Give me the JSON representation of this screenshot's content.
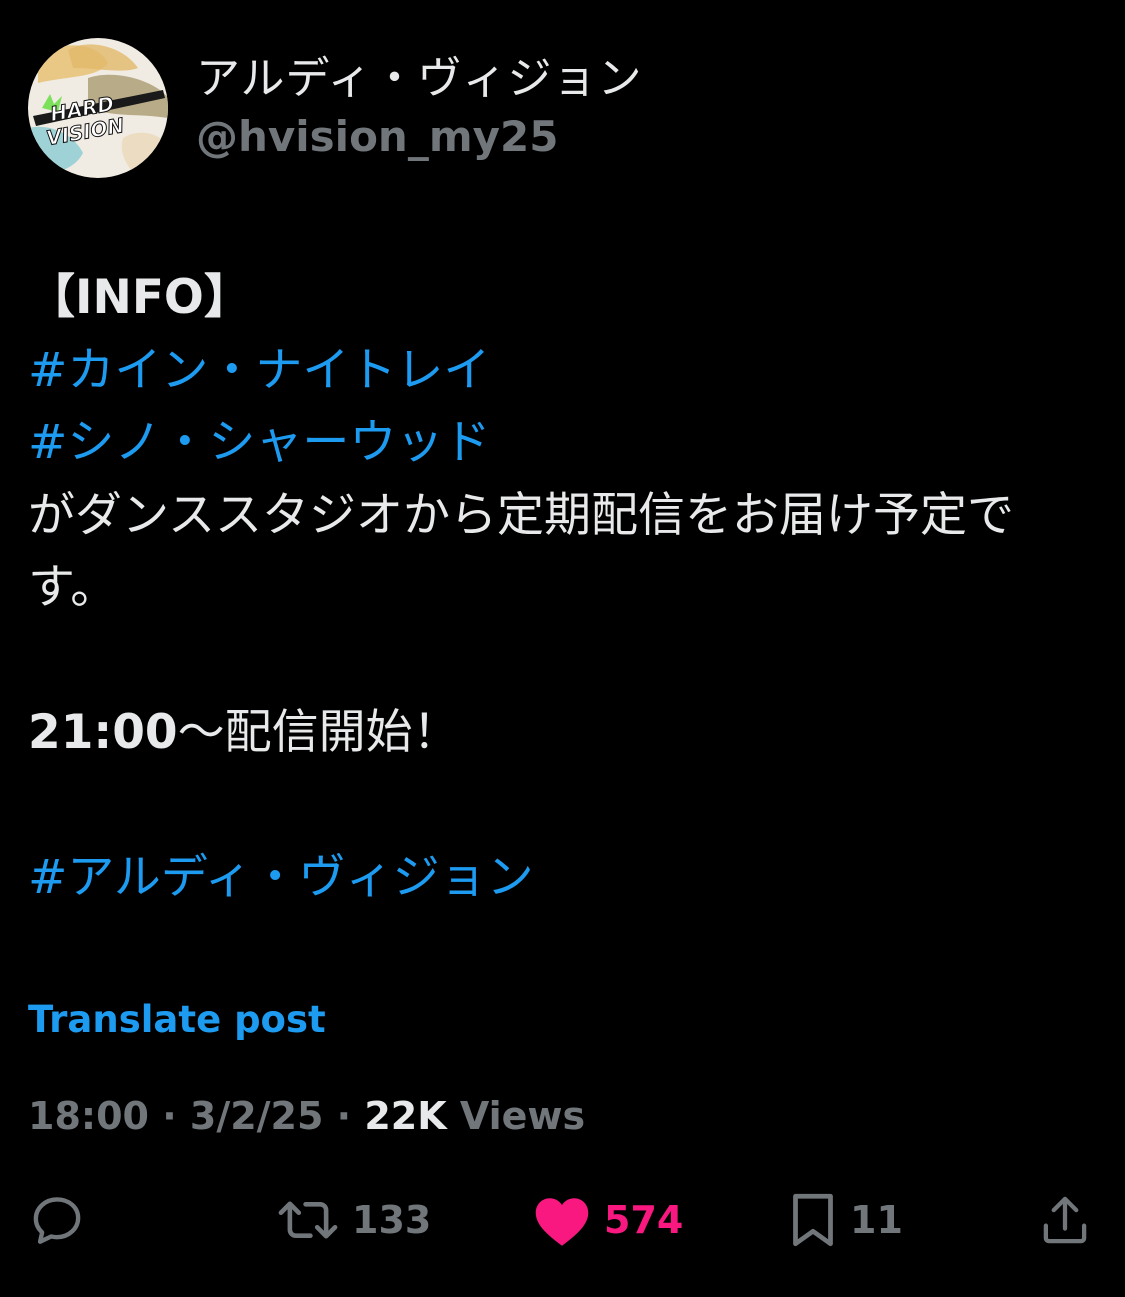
{
  "author": {
    "display_name": "アルディ・ヴィジョン",
    "handle": "@hvision_my25",
    "avatar_logo_text": [
      "HARD",
      "VISION"
    ]
  },
  "post": {
    "lines": [
      "【INFO】",
      "#カイン・ナイトレイ",
      "#シノ・シャーウッド",
      "がダンススタジオから定期配信をお届け予定です。",
      "21:00〜配信開始！",
      "#アルディ・ヴィジョン"
    ]
  },
  "translate_label": "Translate post",
  "meta": {
    "time": "18:00",
    "separator": "·",
    "date": "3/2/25",
    "views_count": "22K",
    "views_label": "Views"
  },
  "actions": {
    "reply": {
      "icon": "reply-icon"
    },
    "repost": {
      "icon": "repost-icon",
      "count": "133"
    },
    "like": {
      "icon": "heart-icon",
      "count": "574",
      "liked": true
    },
    "bookmark": {
      "icon": "bookmark-icon",
      "count": "11"
    },
    "share": {
      "icon": "share-icon"
    }
  },
  "colors": {
    "background": "#000000",
    "text": "#e7e9ea",
    "muted": "#71767b",
    "link": "#1d9bf0",
    "like": "#f91880"
  }
}
